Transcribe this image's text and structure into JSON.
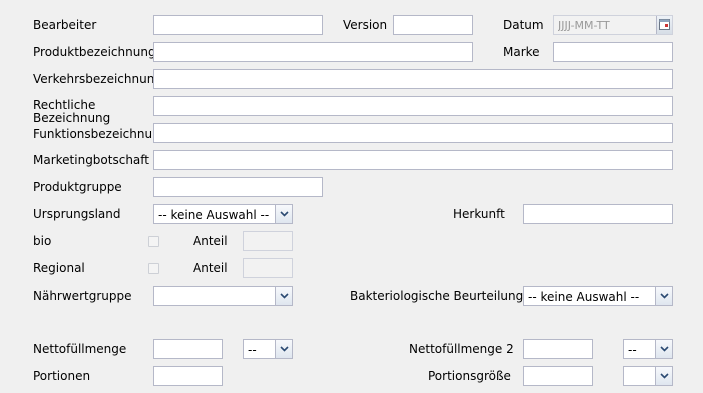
{
  "labels": {
    "bearbeiter": "Bearbeiter",
    "version": "Version",
    "datum": "Datum",
    "produktbezeichnung": "Produktbezeichnung",
    "marke": "Marke",
    "verkehrsbezeichnung": "Verkehrsbezeichnung",
    "rechtliche": "Rechtliche Bezeichnung",
    "funktionsbezeichnung": "Funktionsbezeichnung",
    "marketingbotschaft": "Marketingbotschaft",
    "produktgruppe": "Produktgruppe",
    "ursprungsland": "Ursprungsland",
    "herkunft": "Herkunft",
    "bio": "bio",
    "anteil1": "Anteil",
    "regional": "Regional",
    "anteil2": "Anteil",
    "naehrwertgruppe": "Nährwertgruppe",
    "bakteriologische": "Bakteriologische Beurteilung",
    "nettofuellmenge": "Nettofüllmenge",
    "nettofuellmenge2": "Nettofüllmenge 2",
    "portionen": "Portionen",
    "portionsgroesse": "Portionsgröße"
  },
  "fields": {
    "datum_placeholder": "JJJJ-MM-TT",
    "ursprungsland_value": "-- keine Auswahl --",
    "naehrwertgruppe_value": "",
    "bakteriologische_value": "-- keine Auswahl --",
    "netto_unit_value": "--",
    "netto2_unit_value": "--",
    "portionsgroesse_unit_value": ""
  },
  "icons": {
    "dropdown": "chevron-down-icon",
    "calendar": "calendar-icon"
  }
}
